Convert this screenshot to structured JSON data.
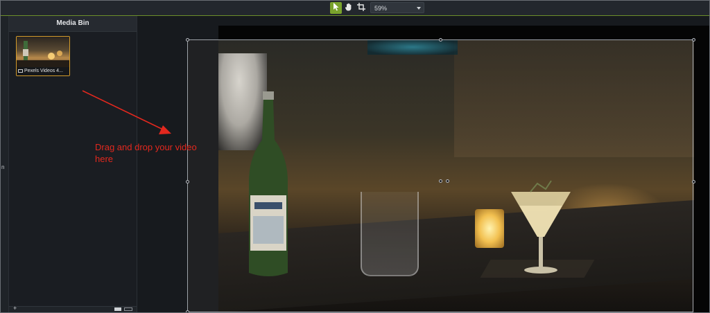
{
  "toolbar": {
    "tools": [
      {
        "name": "select",
        "icon": "cursor-arrow-icon",
        "active": true
      },
      {
        "name": "pan",
        "icon": "hand-icon",
        "active": false
      },
      {
        "name": "crop",
        "icon": "crop-icon",
        "active": false
      }
    ],
    "zoom_value": "59%",
    "accent_color": "#7aa32c"
  },
  "left_strip": {
    "label": "n"
  },
  "media_bin": {
    "title": "Media Bin",
    "items": [
      {
        "caption": "Pexels Videos 4...",
        "type_icon": "film-icon"
      }
    ],
    "footer": {
      "add_label": "+"
    }
  },
  "annotation": {
    "text": "Drag and drop your video here",
    "color": "#e3281e"
  }
}
